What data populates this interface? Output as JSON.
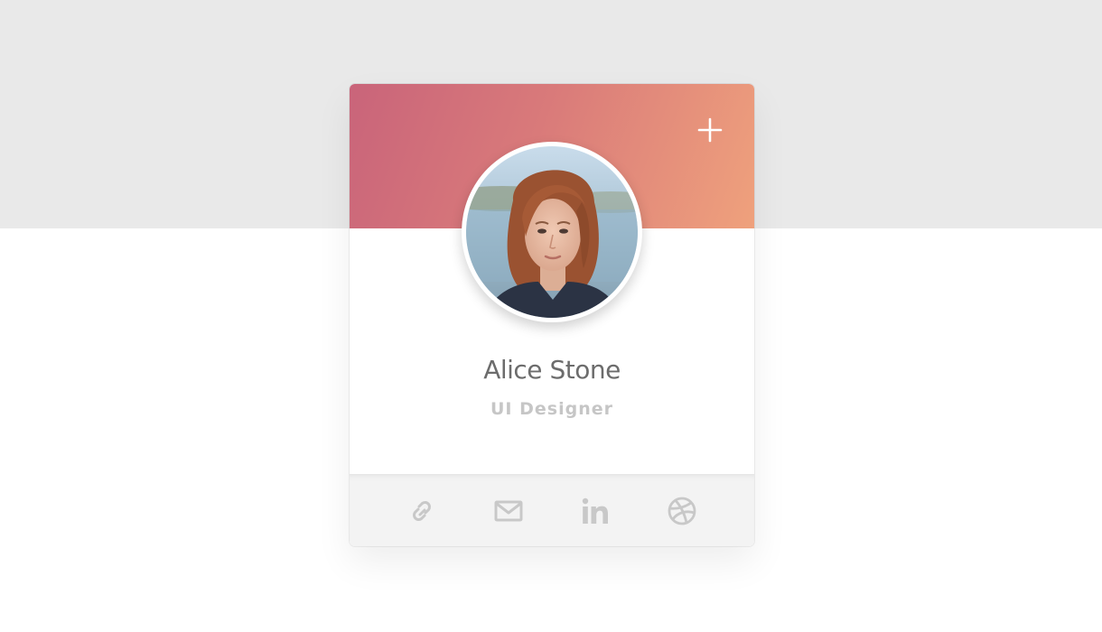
{
  "profile": {
    "name": "Alice Stone",
    "role": "UI Designer"
  },
  "actions": {
    "add_icon": "plus-icon"
  },
  "social": [
    {
      "icon": "link-icon"
    },
    {
      "icon": "mail-icon"
    },
    {
      "icon": "linkedin-icon"
    },
    {
      "icon": "dribbble-icon"
    }
  ],
  "colors": {
    "header_gradient_start": "#c9647a",
    "header_gradient_end": "#efa17c",
    "page_top_background": "#e9e9e9",
    "name_text": "#6c6c6c",
    "role_text": "#c6c6c6",
    "footer_background": "#f3f3f3",
    "icon_gray": "#c8c8c8"
  }
}
